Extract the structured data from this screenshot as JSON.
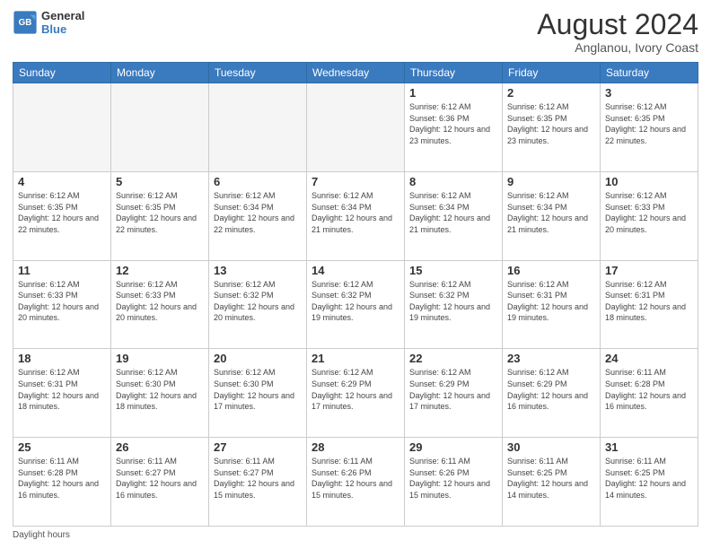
{
  "header": {
    "logo_line1": "General",
    "logo_line2": "Blue",
    "title": "August 2024",
    "subtitle": "Anglanou, Ivory Coast"
  },
  "calendar": {
    "days_of_week": [
      "Sunday",
      "Monday",
      "Tuesday",
      "Wednesday",
      "Thursday",
      "Friday",
      "Saturday"
    ],
    "weeks": [
      [
        {
          "day": "",
          "info": ""
        },
        {
          "day": "",
          "info": ""
        },
        {
          "day": "",
          "info": ""
        },
        {
          "day": "",
          "info": ""
        },
        {
          "day": "1",
          "info": "Sunrise: 6:12 AM\nSunset: 6:36 PM\nDaylight: 12 hours\nand 23 minutes."
        },
        {
          "day": "2",
          "info": "Sunrise: 6:12 AM\nSunset: 6:35 PM\nDaylight: 12 hours\nand 23 minutes."
        },
        {
          "day": "3",
          "info": "Sunrise: 6:12 AM\nSunset: 6:35 PM\nDaylight: 12 hours\nand 22 minutes."
        }
      ],
      [
        {
          "day": "4",
          "info": "Sunrise: 6:12 AM\nSunset: 6:35 PM\nDaylight: 12 hours\nand 22 minutes."
        },
        {
          "day": "5",
          "info": "Sunrise: 6:12 AM\nSunset: 6:35 PM\nDaylight: 12 hours\nand 22 minutes."
        },
        {
          "day": "6",
          "info": "Sunrise: 6:12 AM\nSunset: 6:34 PM\nDaylight: 12 hours\nand 22 minutes."
        },
        {
          "day": "7",
          "info": "Sunrise: 6:12 AM\nSunset: 6:34 PM\nDaylight: 12 hours\nand 21 minutes."
        },
        {
          "day": "8",
          "info": "Sunrise: 6:12 AM\nSunset: 6:34 PM\nDaylight: 12 hours\nand 21 minutes."
        },
        {
          "day": "9",
          "info": "Sunrise: 6:12 AM\nSunset: 6:34 PM\nDaylight: 12 hours\nand 21 minutes."
        },
        {
          "day": "10",
          "info": "Sunrise: 6:12 AM\nSunset: 6:33 PM\nDaylight: 12 hours\nand 20 minutes."
        }
      ],
      [
        {
          "day": "11",
          "info": "Sunrise: 6:12 AM\nSunset: 6:33 PM\nDaylight: 12 hours\nand 20 minutes."
        },
        {
          "day": "12",
          "info": "Sunrise: 6:12 AM\nSunset: 6:33 PM\nDaylight: 12 hours\nand 20 minutes."
        },
        {
          "day": "13",
          "info": "Sunrise: 6:12 AM\nSunset: 6:32 PM\nDaylight: 12 hours\nand 20 minutes."
        },
        {
          "day": "14",
          "info": "Sunrise: 6:12 AM\nSunset: 6:32 PM\nDaylight: 12 hours\nand 19 minutes."
        },
        {
          "day": "15",
          "info": "Sunrise: 6:12 AM\nSunset: 6:32 PM\nDaylight: 12 hours\nand 19 minutes."
        },
        {
          "day": "16",
          "info": "Sunrise: 6:12 AM\nSunset: 6:31 PM\nDaylight: 12 hours\nand 19 minutes."
        },
        {
          "day": "17",
          "info": "Sunrise: 6:12 AM\nSunset: 6:31 PM\nDaylight: 12 hours\nand 18 minutes."
        }
      ],
      [
        {
          "day": "18",
          "info": "Sunrise: 6:12 AM\nSunset: 6:31 PM\nDaylight: 12 hours\nand 18 minutes."
        },
        {
          "day": "19",
          "info": "Sunrise: 6:12 AM\nSunset: 6:30 PM\nDaylight: 12 hours\nand 18 minutes."
        },
        {
          "day": "20",
          "info": "Sunrise: 6:12 AM\nSunset: 6:30 PM\nDaylight: 12 hours\nand 17 minutes."
        },
        {
          "day": "21",
          "info": "Sunrise: 6:12 AM\nSunset: 6:29 PM\nDaylight: 12 hours\nand 17 minutes."
        },
        {
          "day": "22",
          "info": "Sunrise: 6:12 AM\nSunset: 6:29 PM\nDaylight: 12 hours\nand 17 minutes."
        },
        {
          "day": "23",
          "info": "Sunrise: 6:12 AM\nSunset: 6:29 PM\nDaylight: 12 hours\nand 16 minutes."
        },
        {
          "day": "24",
          "info": "Sunrise: 6:11 AM\nSunset: 6:28 PM\nDaylight: 12 hours\nand 16 minutes."
        }
      ],
      [
        {
          "day": "25",
          "info": "Sunrise: 6:11 AM\nSunset: 6:28 PM\nDaylight: 12 hours\nand 16 minutes."
        },
        {
          "day": "26",
          "info": "Sunrise: 6:11 AM\nSunset: 6:27 PM\nDaylight: 12 hours\nand 16 minutes."
        },
        {
          "day": "27",
          "info": "Sunrise: 6:11 AM\nSunset: 6:27 PM\nDaylight: 12 hours\nand 15 minutes."
        },
        {
          "day": "28",
          "info": "Sunrise: 6:11 AM\nSunset: 6:26 PM\nDaylight: 12 hours\nand 15 minutes."
        },
        {
          "day": "29",
          "info": "Sunrise: 6:11 AM\nSunset: 6:26 PM\nDaylight: 12 hours\nand 15 minutes."
        },
        {
          "day": "30",
          "info": "Sunrise: 6:11 AM\nSunset: 6:25 PM\nDaylight: 12 hours\nand 14 minutes."
        },
        {
          "day": "31",
          "info": "Sunrise: 6:11 AM\nSunset: 6:25 PM\nDaylight: 12 hours\nand 14 minutes."
        }
      ]
    ]
  },
  "footer": {
    "note": "Daylight hours"
  }
}
